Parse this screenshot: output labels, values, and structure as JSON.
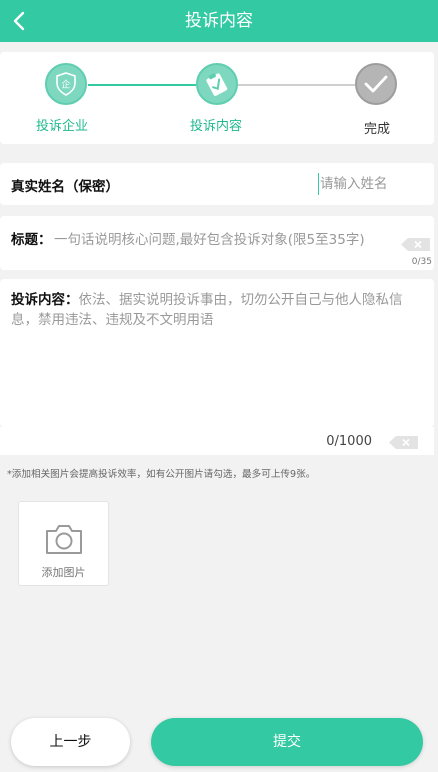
{
  "header": {
    "title": "投诉内容",
    "back_icon": "chevron-left-icon"
  },
  "steps": [
    {
      "label": "投诉企业",
      "icon": "shield-enterprise-icon",
      "state": "done"
    },
    {
      "label": "投诉内容",
      "icon": "clipboard-check-icon",
      "state": "active"
    },
    {
      "label": "完成",
      "icon": "check-icon",
      "state": "pending"
    }
  ],
  "form": {
    "name_label": "真实姓名（保密）",
    "name_placeholder": "请输入姓名",
    "title_label": "标题：",
    "title_placeholder": "一句话说明核心问题,最好包含投诉对象(限5至35字)",
    "title_counter": "0/35",
    "content_label": "投诉内容：",
    "content_placeholder": "依法、据实说明投诉事由，切勿公开自己与他人隐私信息，禁用违法、违规及不文明用语",
    "content_counter": "0/1000"
  },
  "hint": "*添加相关图片会提高投诉效率，如有公开图片请勾选，最多可上传9张。",
  "add_photo": {
    "label": "添加图片",
    "icon": "camera-icon"
  },
  "buttons": {
    "prev_label": "上一步",
    "submit_label": "提交"
  },
  "colors": {
    "brand": "#33c9a3",
    "brand_light": "#7ed8bf",
    "pending": "#b5b5b5",
    "background": "#f2f2f2"
  }
}
